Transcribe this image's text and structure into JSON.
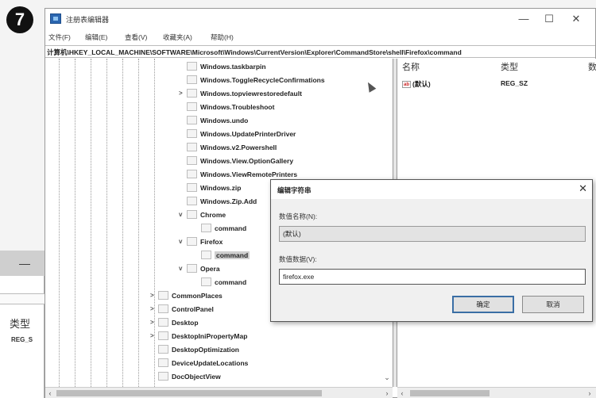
{
  "step": "7",
  "background_window": {
    "col_type": "类型",
    "row_value": "REG_S"
  },
  "window": {
    "title": "注册表编辑器",
    "controls": {
      "minimize": "—",
      "maximize": "☐",
      "close": "✕"
    }
  },
  "menu": [
    "文件(F)",
    "编辑(E)",
    "查看(V)",
    "收藏夹(A)",
    "帮助(H)"
  ],
  "address": "计算机\\HKEY_LOCAL_MACHINE\\SOFTWARE\\Microsoft\\Windows\\CurrentVersion\\Explorer\\CommandStore\\shell\\Firefox\\command",
  "tree": [
    {
      "label": "Windows.taskbarpin",
      "level": 2,
      "expander": ""
    },
    {
      "label": "Windows.ToggleRecycleConfirmations",
      "level": 2,
      "expander": ""
    },
    {
      "label": "Windows.topviewrestoredefault",
      "level": 2,
      "expander": ">"
    },
    {
      "label": "Windows.Troubleshoot",
      "level": 2,
      "expander": ""
    },
    {
      "label": "Windows.undo",
      "level": 2,
      "expander": ""
    },
    {
      "label": "Windows.UpdatePrinterDriver",
      "level": 2,
      "expander": ""
    },
    {
      "label": "Windows.v2.Powershell",
      "level": 2,
      "expander": ""
    },
    {
      "label": "Windows.View.OptionGallery",
      "level": 2,
      "expander": ""
    },
    {
      "label": "Windows.ViewRemotePrinters",
      "level": 2,
      "expander": ""
    },
    {
      "label": "Windows.zip",
      "level": 2,
      "expander": ""
    },
    {
      "label": "Windows.Zip.Add",
      "level": 2,
      "expander": ""
    },
    {
      "label": "Chrome",
      "level": 2,
      "expander": "v"
    },
    {
      "label": "command",
      "level": 3,
      "expander": ""
    },
    {
      "label": "Firefox",
      "level": 2,
      "expander": "v"
    },
    {
      "label": "command",
      "level": 3,
      "expander": "",
      "selected": true
    },
    {
      "label": "Opera",
      "level": 2,
      "expander": "v"
    },
    {
      "label": "command",
      "level": 3,
      "expander": ""
    },
    {
      "label": "CommonPlaces",
      "level": 1,
      "expander": ">"
    },
    {
      "label": "ControlPanel",
      "level": 1,
      "expander": ">"
    },
    {
      "label": "Desktop",
      "level": 1,
      "expander": ">"
    },
    {
      "label": "DesktopIniPropertyMap",
      "level": 1,
      "expander": ">"
    },
    {
      "label": "DesktopOptimization",
      "level": 1,
      "expander": ""
    },
    {
      "label": "DeviceUpdateLocations",
      "level": 1,
      "expander": ""
    },
    {
      "label": "DocObjectView",
      "level": 1,
      "expander": ""
    }
  ],
  "values_pane": {
    "headers": {
      "name": "名称",
      "type": "类型",
      "data": "数"
    },
    "rows": [
      {
        "icon": "ab",
        "name": "(默认)",
        "type": "REG_SZ"
      }
    ]
  },
  "dialog": {
    "title": "编辑字符串",
    "name_label": "数值名称(N):",
    "name_value": "(默认)",
    "data_label": "数值数据(V):",
    "data_value": "firefox.exe",
    "ok": "确定",
    "cancel": "取消",
    "close": "✕"
  }
}
